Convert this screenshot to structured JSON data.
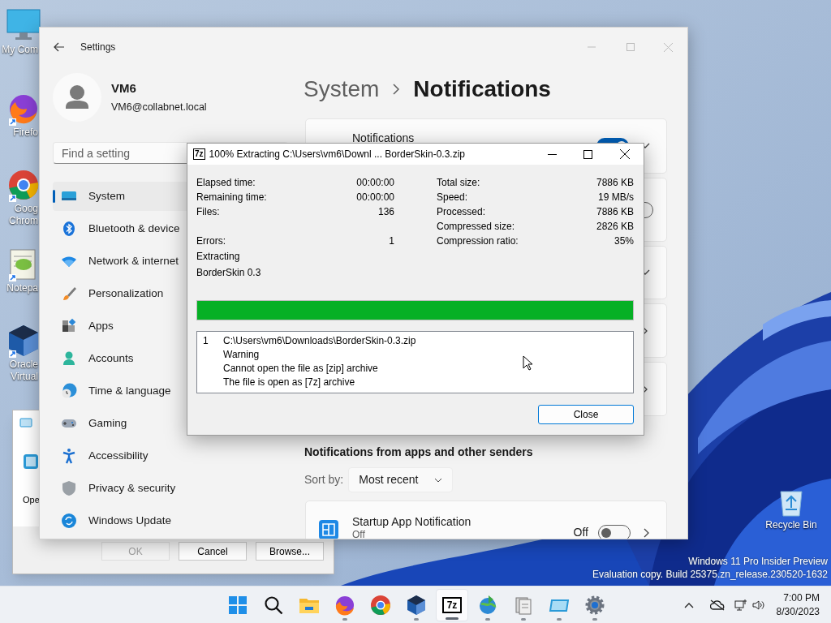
{
  "desktop": {
    "icons": [
      {
        "lines": [
          "My Com"
        ]
      },
      {
        "lines": [
          "Firefo"
        ]
      },
      {
        "lines": [
          "Goog",
          "Chrom"
        ]
      },
      {
        "lines": [
          "Notepa"
        ]
      },
      {
        "lines": [
          "Oracle",
          "Virtual"
        ]
      }
    ],
    "recycle_bin": {
      "label": "Recycle Bin"
    },
    "watermark": [
      "Windows 11 Pro Insider Preview",
      "Evaluation copy. Build 25375.zn_release.230520-1632"
    ]
  },
  "run_dialog": {
    "label": "Ope",
    "buttons": [
      {
        "label": "OK",
        "disabled": true
      },
      {
        "label": "Cancel",
        "disabled": false
      },
      {
        "label": "Browse...",
        "disabled": false
      }
    ]
  },
  "settings": {
    "title": "Settings",
    "user": {
      "name": "VM6",
      "email": "VM6@collabnet.local"
    },
    "search": {
      "placeholder": "Find a setting"
    },
    "nav": [
      {
        "label": "System",
        "selected": true
      },
      {
        "label": "Bluetooth & device",
        "selected": false
      },
      {
        "label": "Network & internet",
        "selected": false
      },
      {
        "label": "Personalization",
        "selected": false
      },
      {
        "label": "Apps",
        "selected": false
      },
      {
        "label": "Accounts",
        "selected": false
      },
      {
        "label": "Time & language",
        "selected": false
      },
      {
        "label": "Gaming",
        "selected": false
      },
      {
        "label": "Accessibility",
        "selected": false
      },
      {
        "label": "Privacy & security",
        "selected": false
      },
      {
        "label": "Windows Update",
        "selected": false
      }
    ],
    "breadcrumb": {
      "parent": "System",
      "current": "Notifications"
    },
    "cards": [
      {
        "kind": "toggle-expand",
        "title": "Notifications",
        "on": true
      },
      {
        "kind": "toggle",
        "on": false
      },
      {
        "kind": "expand"
      },
      {
        "kind": "link"
      },
      {
        "kind": "link"
      }
    ],
    "section_title": "Notifications from apps and other senders",
    "sort": {
      "label": "Sort by:",
      "value": "Most recent"
    },
    "apps": [
      {
        "name": "Startup App Notification",
        "status": "Off",
        "state_label": "Off",
        "on": false
      }
    ]
  },
  "extract_dialog": {
    "icon_label": "7z",
    "title": "100% Extracting C:\\Users\\vm6\\Downl ... BorderSkin-0.3.zip",
    "stats": [
      {
        "left": {
          "label": "Elapsed time:",
          "value": "00:00:00"
        },
        "right": {
          "label": "Total size:",
          "value": "7886 KB"
        }
      },
      {
        "left": {
          "label": "Remaining time:",
          "value": "00:00:00"
        },
        "right": {
          "label": "Speed:",
          "value": "19 MB/s"
        }
      },
      {
        "left": {
          "label": "Files:",
          "value": "136"
        },
        "right": {
          "label": "Processed:",
          "value": "7886 KB"
        }
      },
      {
        "right": {
          "label": "Compressed size:",
          "value": "2826 KB"
        }
      },
      {
        "left": {
          "label": "Errors:",
          "value": "1"
        },
        "right": {
          "label": "Compression ratio:",
          "value": "35%"
        }
      }
    ],
    "status_lines": [
      "Extracting",
      "BorderSkin 0.3"
    ],
    "progress": {
      "level": 1
    },
    "log": [
      {
        "index": "1",
        "lines": [
          "C:\\Users\\vm6\\Downloads\\BorderSkin-0.3.zip",
          "Warning",
          "Cannot open the file as [zip] archive",
          "The file is open as [7z] archive"
        ]
      }
    ],
    "close_button": "Close"
  },
  "taskbar": {
    "apps": [
      {
        "open": false,
        "selected": false
      },
      {
        "open": false,
        "selected": false
      },
      {
        "open": false,
        "selected": false
      },
      {
        "open": true,
        "selected": false
      },
      {
        "open": false,
        "selected": false
      },
      {
        "open": true,
        "selected": false
      },
      {
        "open": true,
        "selected": true,
        "label": "7z"
      },
      {
        "open": true,
        "selected": false
      },
      {
        "open": true,
        "selected": false
      },
      {
        "open": true,
        "selected": false
      },
      {
        "open": true,
        "selected": false
      }
    ],
    "time": "7:00 PM",
    "date": "8/30/2023"
  }
}
